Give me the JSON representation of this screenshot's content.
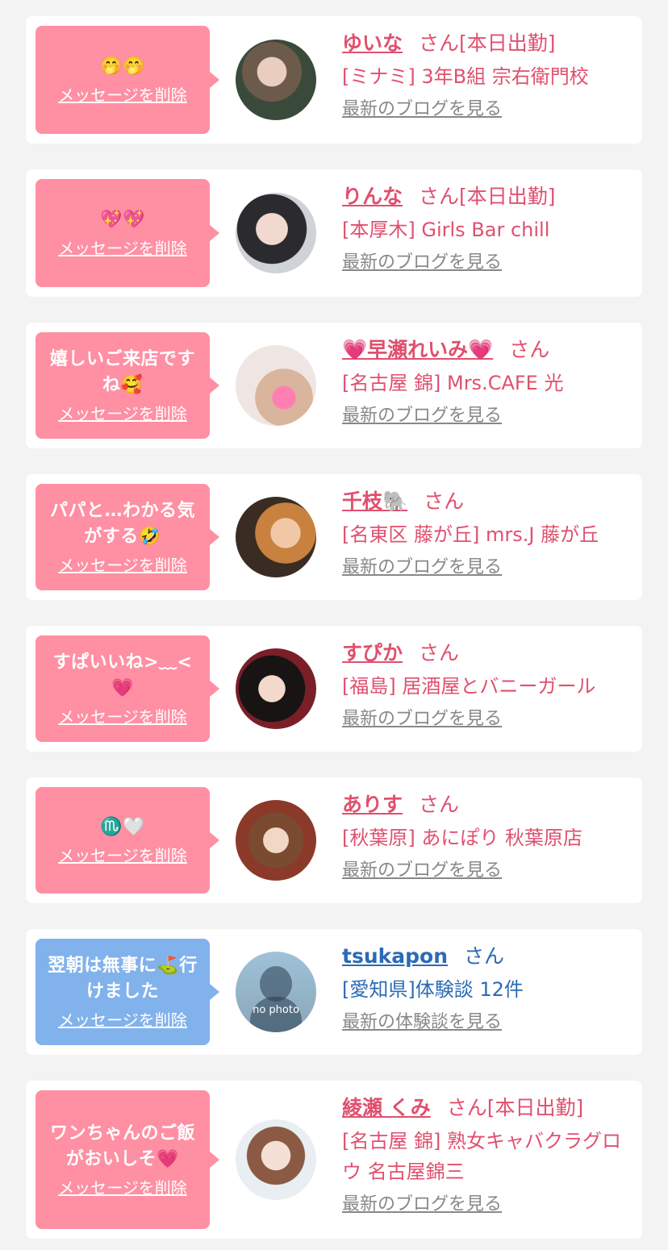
{
  "delete_label": "メッセージを削除",
  "san_label": "さん",
  "messages": [
    {
      "message": "🤭🤭",
      "name": "ゆいな",
      "status": "[本日出勤]",
      "shop": "[ミナミ] 3年B組 宗右衛門校",
      "link": "最新のブログを見る",
      "theme": "pink"
    },
    {
      "message": "💖💖",
      "name": "りんな",
      "status": "[本日出勤]",
      "shop": "[本厚木] Girls Bar chill",
      "link": "最新のブログを見る",
      "theme": "pink"
    },
    {
      "message": "嬉しいご来店ですね🥰",
      "name": "💗早瀬れいみ💗",
      "status": "",
      "shop": "[名古屋 錦] Mrs.CAFE 光",
      "link": "最新のブログを見る",
      "theme": "pink"
    },
    {
      "message": "パパと…わかる気がする🤣",
      "name": "千枝🐘",
      "status": "",
      "shop": "[名東区 藤が丘] mrs.J 藤が丘",
      "link": "最新のブログを見る",
      "theme": "pink"
    },
    {
      "message": "すぱいいね>﹏<💗",
      "name": "すぴか",
      "status": "",
      "shop": "[福島] 居酒屋とバニーガール",
      "link": "最新のブログを見る",
      "theme": "pink"
    },
    {
      "message": "♏️🤍",
      "name": "ありす",
      "status": "",
      "shop": "[秋葉原] あにぽり 秋葉原店",
      "link": "最新のブログを見る",
      "theme": "pink"
    },
    {
      "message": "翌朝は無事に⛳️行けました",
      "name": "tsukapon",
      "status": "",
      "shop": "[愛知県]体験談 12件",
      "link": "最新の体験談を見る",
      "theme": "blue",
      "avatar_text": "no photo"
    },
    {
      "message": "ワンちゃんのご飯がおいしそ💗",
      "name": "綾瀬 くみ",
      "status": "[本日出勤]",
      "shop": "[名古屋 錦] 熟女キャバクラグロウ 名古屋錦三",
      "link": "最新のブログを見る",
      "theme": "pink"
    }
  ],
  "colors": {
    "page_bg": "#f3f3f3",
    "pink_bubble": "#ff8fa3",
    "blue_bubble": "#82b2ec",
    "pink_text": "#e0506e",
    "blue_text": "#2a6bb5",
    "link_gray": "#888888"
  }
}
